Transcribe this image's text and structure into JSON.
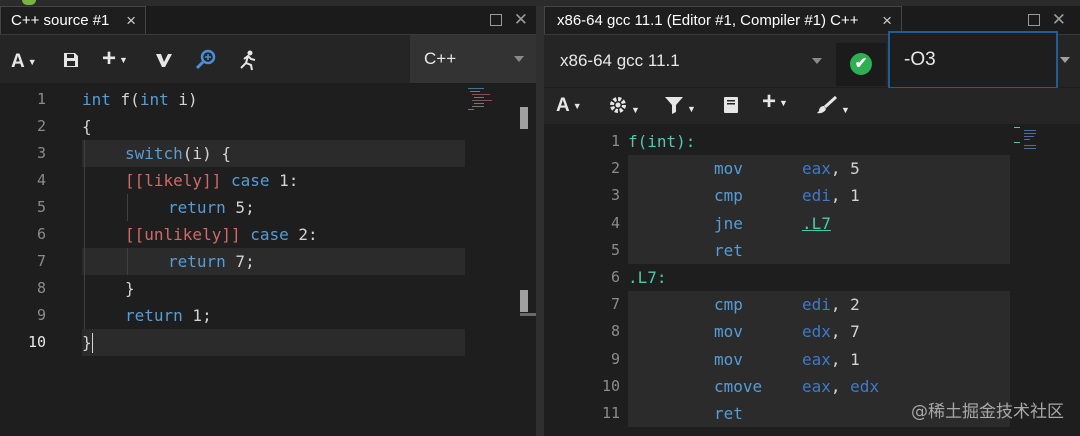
{
  "source_pane": {
    "tab_title": "C++ source #1",
    "tab_close": "×",
    "window_close": "✕",
    "toolbar": {
      "font_label": "A",
      "add_label": "+",
      "language": "C++"
    },
    "lines": [
      {
        "num": "1",
        "tokens": [
          {
            "t": "int",
            "c": "kw"
          },
          {
            "t": " f(",
            "c": "plain"
          },
          {
            "t": "int",
            "c": "kw"
          },
          {
            "t": " i)",
            "c": "plain"
          }
        ],
        "indent": 0
      },
      {
        "num": "2",
        "tokens": [
          {
            "t": "{",
            "c": "plain"
          }
        ],
        "indent": 0
      },
      {
        "num": "3",
        "tokens": [
          {
            "t": "switch",
            "c": "kw"
          },
          {
            "t": "(i) {",
            "c": "plain"
          }
        ],
        "indent": 1
      },
      {
        "num": "4",
        "tokens": [
          {
            "t": "[[likely]]",
            "c": "attr"
          },
          {
            "t": " ",
            "c": "plain"
          },
          {
            "t": "case",
            "c": "kw"
          },
          {
            "t": " 1:",
            "c": "plain"
          }
        ],
        "indent": 1
      },
      {
        "num": "5",
        "tokens": [
          {
            "t": "return",
            "c": "kw"
          },
          {
            "t": " 5;",
            "c": "plain"
          }
        ],
        "indent": 2
      },
      {
        "num": "6",
        "tokens": [
          {
            "t": "[[unlikely]]",
            "c": "attr"
          },
          {
            "t": " ",
            "c": "plain"
          },
          {
            "t": "case",
            "c": "kw"
          },
          {
            "t": " 2:",
            "c": "plain"
          }
        ],
        "indent": 1
      },
      {
        "num": "7",
        "tokens": [
          {
            "t": "return",
            "c": "kw"
          },
          {
            "t": " 7;",
            "c": "plain"
          }
        ],
        "indent": 2
      },
      {
        "num": "8",
        "tokens": [
          {
            "t": "}",
            "c": "plain"
          }
        ],
        "indent": 1
      },
      {
        "num": "9",
        "tokens": [
          {
            "t": "return",
            "c": "kw"
          },
          {
            "t": " 1;",
            "c": "plain"
          }
        ],
        "indent": 1
      },
      {
        "num": "10",
        "tokens": [
          {
            "t": "}",
            "c": "plain"
          }
        ],
        "indent": 0
      }
    ]
  },
  "compiler_pane": {
    "tab_title": "x86-64 gcc 11.1 (Editor #1, Compiler #1) C++",
    "tab_close": "×",
    "window_close": "✕",
    "compiler_select": "x86-64 gcc 11.1",
    "status": "compiled-ok",
    "status_glyph": "✔",
    "options": "-O3",
    "toolbar": {
      "font_label": "A",
      "add_label": "+"
    },
    "lines": [
      {
        "num": "1",
        "label": "f(int):"
      },
      {
        "num": "2",
        "op": "mov",
        "args": [
          {
            "t": "eax",
            "c": "reg"
          },
          {
            "t": ", 5",
            "c": "plain"
          }
        ]
      },
      {
        "num": "3",
        "op": "cmp",
        "args": [
          {
            "t": "edi",
            "c": "reg"
          },
          {
            "t": ", 1",
            "c": "plain"
          }
        ]
      },
      {
        "num": "4",
        "op": "jne",
        "args": [
          {
            "t": ".L7",
            "c": "lref"
          }
        ]
      },
      {
        "num": "5",
        "op": "ret",
        "args": []
      },
      {
        "num": "6",
        "label": ".L7:"
      },
      {
        "num": "7",
        "op": "cmp",
        "args": [
          {
            "t": "edi",
            "c": "reg"
          },
          {
            "t": ", 2",
            "c": "plain"
          }
        ]
      },
      {
        "num": "8",
        "op": "mov",
        "args": [
          {
            "t": "edx",
            "c": "reg"
          },
          {
            "t": ", 7",
            "c": "plain"
          }
        ]
      },
      {
        "num": "9",
        "op": "mov",
        "args": [
          {
            "t": "eax",
            "c": "reg"
          },
          {
            "t": ", 1",
            "c": "plain"
          }
        ]
      },
      {
        "num": "10",
        "op": "cmove",
        "args": [
          {
            "t": "eax",
            "c": "reg"
          },
          {
            "t": ", ",
            "c": "plain"
          },
          {
            "t": "edx",
            "c": "reg"
          }
        ]
      },
      {
        "num": "11",
        "op": "ret",
        "args": []
      }
    ]
  },
  "watermark": "@稀土掘金技术社区",
  "colors": {
    "keyword": "#569cd6",
    "attribute": "#d16969",
    "label": "#4ec9b0",
    "register": "#3e7ac7",
    "status_ok": "#2fae52",
    "focus_border": "#1f5c9a"
  }
}
